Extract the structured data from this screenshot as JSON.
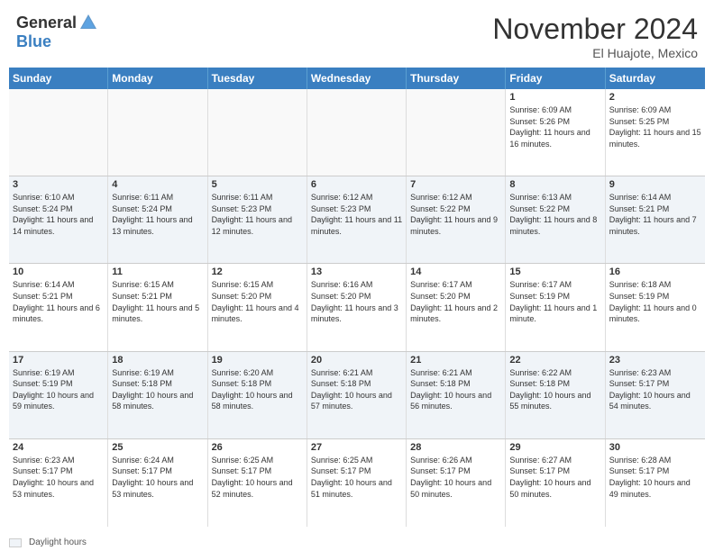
{
  "logo": {
    "general": "General",
    "blue": "Blue"
  },
  "header": {
    "month": "November 2024",
    "location": "El Huajote, Mexico"
  },
  "weekdays": [
    "Sunday",
    "Monday",
    "Tuesday",
    "Wednesday",
    "Thursday",
    "Friday",
    "Saturday"
  ],
  "weeks": [
    [
      {
        "day": "",
        "info": ""
      },
      {
        "day": "",
        "info": ""
      },
      {
        "day": "",
        "info": ""
      },
      {
        "day": "",
        "info": ""
      },
      {
        "day": "",
        "info": ""
      },
      {
        "day": "1",
        "info": "Sunrise: 6:09 AM\nSunset: 5:26 PM\nDaylight: 11 hours and 16 minutes."
      },
      {
        "day": "2",
        "info": "Sunrise: 6:09 AM\nSunset: 5:25 PM\nDaylight: 11 hours and 15 minutes."
      }
    ],
    [
      {
        "day": "3",
        "info": "Sunrise: 6:10 AM\nSunset: 5:24 PM\nDaylight: 11 hours and 14 minutes."
      },
      {
        "day": "4",
        "info": "Sunrise: 6:11 AM\nSunset: 5:24 PM\nDaylight: 11 hours and 13 minutes."
      },
      {
        "day": "5",
        "info": "Sunrise: 6:11 AM\nSunset: 5:23 PM\nDaylight: 11 hours and 12 minutes."
      },
      {
        "day": "6",
        "info": "Sunrise: 6:12 AM\nSunset: 5:23 PM\nDaylight: 11 hours and 11 minutes."
      },
      {
        "day": "7",
        "info": "Sunrise: 6:12 AM\nSunset: 5:22 PM\nDaylight: 11 hours and 9 minutes."
      },
      {
        "day": "8",
        "info": "Sunrise: 6:13 AM\nSunset: 5:22 PM\nDaylight: 11 hours and 8 minutes."
      },
      {
        "day": "9",
        "info": "Sunrise: 6:14 AM\nSunset: 5:21 PM\nDaylight: 11 hours and 7 minutes."
      }
    ],
    [
      {
        "day": "10",
        "info": "Sunrise: 6:14 AM\nSunset: 5:21 PM\nDaylight: 11 hours and 6 minutes."
      },
      {
        "day": "11",
        "info": "Sunrise: 6:15 AM\nSunset: 5:21 PM\nDaylight: 11 hours and 5 minutes."
      },
      {
        "day": "12",
        "info": "Sunrise: 6:15 AM\nSunset: 5:20 PM\nDaylight: 11 hours and 4 minutes."
      },
      {
        "day": "13",
        "info": "Sunrise: 6:16 AM\nSunset: 5:20 PM\nDaylight: 11 hours and 3 minutes."
      },
      {
        "day": "14",
        "info": "Sunrise: 6:17 AM\nSunset: 5:20 PM\nDaylight: 11 hours and 2 minutes."
      },
      {
        "day": "15",
        "info": "Sunrise: 6:17 AM\nSunset: 5:19 PM\nDaylight: 11 hours and 1 minute."
      },
      {
        "day": "16",
        "info": "Sunrise: 6:18 AM\nSunset: 5:19 PM\nDaylight: 11 hours and 0 minutes."
      }
    ],
    [
      {
        "day": "17",
        "info": "Sunrise: 6:19 AM\nSunset: 5:19 PM\nDaylight: 10 hours and 59 minutes."
      },
      {
        "day": "18",
        "info": "Sunrise: 6:19 AM\nSunset: 5:18 PM\nDaylight: 10 hours and 58 minutes."
      },
      {
        "day": "19",
        "info": "Sunrise: 6:20 AM\nSunset: 5:18 PM\nDaylight: 10 hours and 58 minutes."
      },
      {
        "day": "20",
        "info": "Sunrise: 6:21 AM\nSunset: 5:18 PM\nDaylight: 10 hours and 57 minutes."
      },
      {
        "day": "21",
        "info": "Sunrise: 6:21 AM\nSunset: 5:18 PM\nDaylight: 10 hours and 56 minutes."
      },
      {
        "day": "22",
        "info": "Sunrise: 6:22 AM\nSunset: 5:18 PM\nDaylight: 10 hours and 55 minutes."
      },
      {
        "day": "23",
        "info": "Sunrise: 6:23 AM\nSunset: 5:17 PM\nDaylight: 10 hours and 54 minutes."
      }
    ],
    [
      {
        "day": "24",
        "info": "Sunrise: 6:23 AM\nSunset: 5:17 PM\nDaylight: 10 hours and 53 minutes."
      },
      {
        "day": "25",
        "info": "Sunrise: 6:24 AM\nSunset: 5:17 PM\nDaylight: 10 hours and 53 minutes."
      },
      {
        "day": "26",
        "info": "Sunrise: 6:25 AM\nSunset: 5:17 PM\nDaylight: 10 hours and 52 minutes."
      },
      {
        "day": "27",
        "info": "Sunrise: 6:25 AM\nSunset: 5:17 PM\nDaylight: 10 hours and 51 minutes."
      },
      {
        "day": "28",
        "info": "Sunrise: 6:26 AM\nSunset: 5:17 PM\nDaylight: 10 hours and 50 minutes."
      },
      {
        "day": "29",
        "info": "Sunrise: 6:27 AM\nSunset: 5:17 PM\nDaylight: 10 hours and 50 minutes."
      },
      {
        "day": "30",
        "info": "Sunrise: 6:28 AM\nSunset: 5:17 PM\nDaylight: 10 hours and 49 minutes."
      }
    ]
  ],
  "legend": {
    "text": "Daylight hours"
  }
}
